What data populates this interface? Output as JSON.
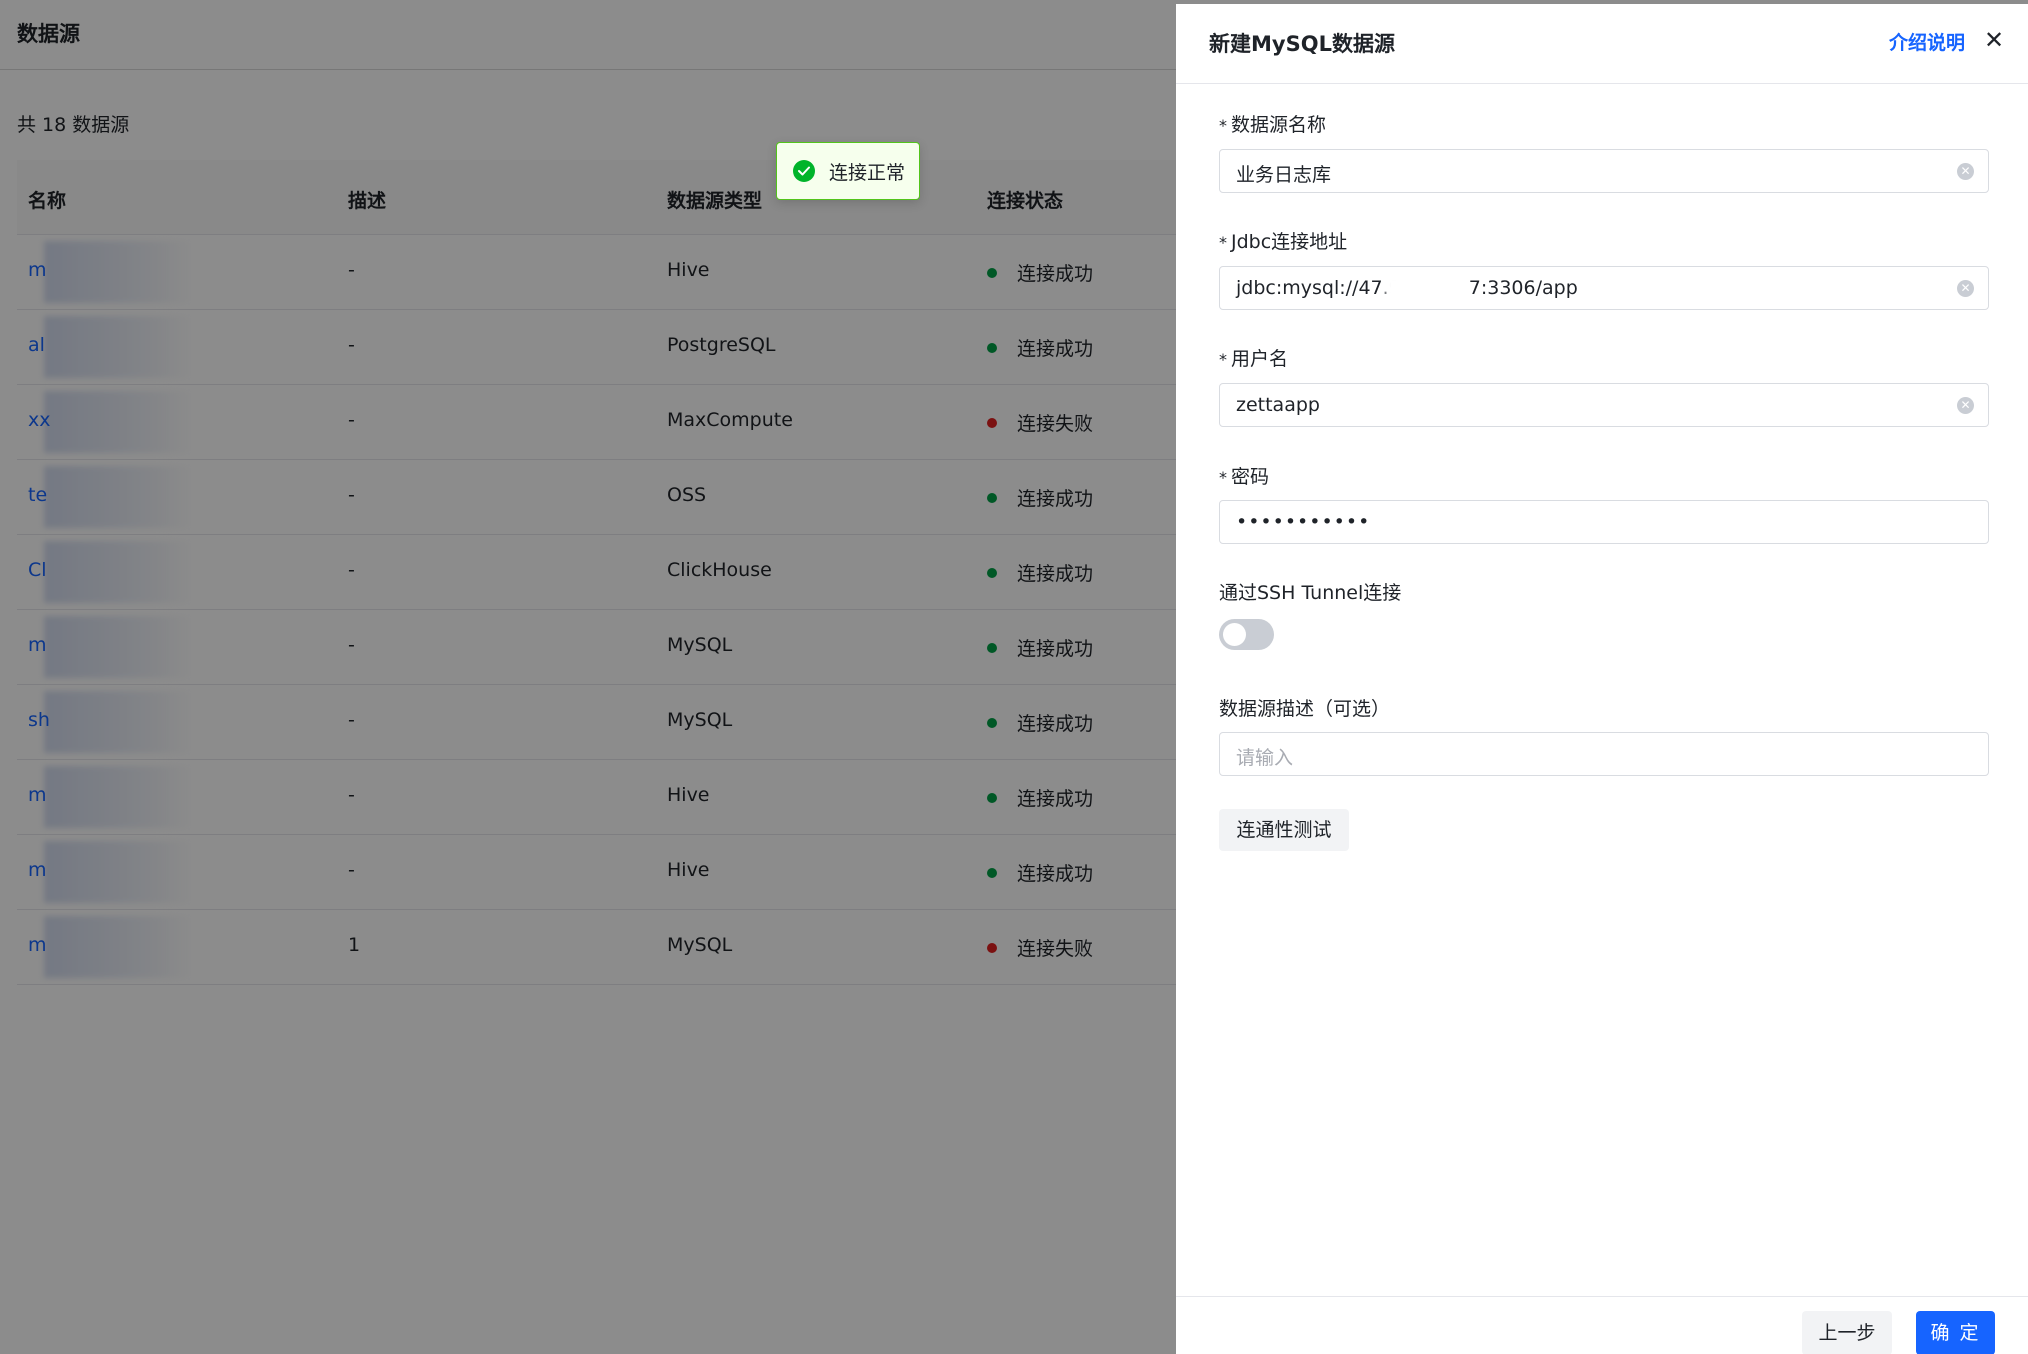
{
  "page": {
    "title": "数据源",
    "total_text": "共 18 数据源"
  },
  "table": {
    "headers": [
      "名称",
      "描述",
      "数据源类型",
      "连接状态"
    ],
    "rows": [
      {
        "name": "m",
        "desc": "-",
        "type": "Hive",
        "status": "连接成功",
        "status_color": "#00a046"
      },
      {
        "name": "al",
        "desc": "-",
        "type": "PostgreSQL",
        "status": "连接成功",
        "status_color": "#00a046"
      },
      {
        "name": "xx",
        "desc": "-",
        "type": "MaxCompute",
        "status": "连接失败",
        "status_color": "#e02020"
      },
      {
        "name": "te",
        "desc": "-",
        "type": "OSS",
        "status": "连接成功",
        "status_color": "#00a046"
      },
      {
        "name": "Cl",
        "desc": "-",
        "type": "ClickHouse",
        "status": "连接成功",
        "status_color": "#00a046"
      },
      {
        "name": "m",
        "desc": "-",
        "type": "MySQL",
        "status": "连接成功",
        "status_color": "#00a046"
      },
      {
        "name": "sh",
        "desc": "-",
        "type": "MySQL",
        "status": "连接成功",
        "status_color": "#00a046"
      },
      {
        "name": "m",
        "desc": "-",
        "type": "Hive",
        "status": "连接成功",
        "status_color": "#00a046"
      },
      {
        "name": "m",
        "desc": "-",
        "type": "Hive",
        "status": "连接成功",
        "status_color": "#00a046"
      },
      {
        "name": "m",
        "desc": "1",
        "type": "MySQL",
        "status": "连接失败",
        "status_color": "#e02020"
      }
    ]
  },
  "toast": {
    "text": "连接正常",
    "icon": "check-circle-icon"
  },
  "drawer": {
    "title": "新建MySQL数据源",
    "intro_link": "介绍说明",
    "close_icon": "close-icon",
    "fields": {
      "name": {
        "label": "数据源名称",
        "required": true,
        "value": "业务日志库"
      },
      "jdbc": {
        "label": "Jdbc连接地址",
        "required": true,
        "value_prefix": "jdbc:mysql://47.9",
        "value_suffix": "7:3306/app"
      },
      "username": {
        "label": "用户名",
        "required": true,
        "value": "zettaapp"
      },
      "password": {
        "label": "密码",
        "required": true,
        "value": "•••••••••••"
      },
      "ssh": {
        "label": "通过SSH Tunnel连接",
        "enabled": false
      },
      "description": {
        "label": "数据源描述（可选）",
        "value": "",
        "placeholder": "请输入"
      }
    },
    "test_button": "连通性测试",
    "prev_button": "上一步",
    "ok_button": "确 定"
  },
  "required_mark": "*",
  "colors": {
    "primary": "#1664ff",
    "success": "#00a046",
    "error": "#e02020",
    "overlay": "rgba(0,0,0,0.45)"
  }
}
